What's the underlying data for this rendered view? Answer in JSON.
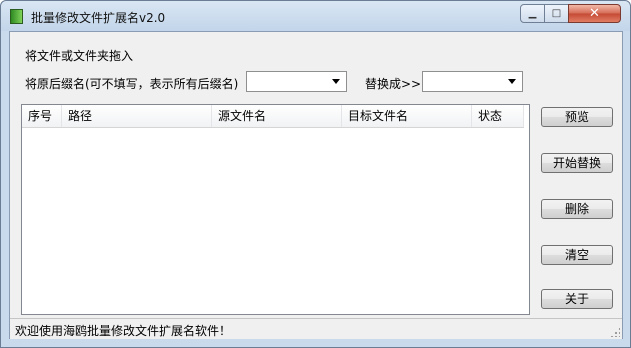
{
  "window": {
    "title": "批量修改文件扩展名v2.0",
    "caption": {
      "min_icon": "minimize-icon",
      "max_icon": "maximize-icon",
      "close_icon": "close-icon"
    }
  },
  "form": {
    "drop_hint": "将文件或文件夹拖入",
    "original_label": "将原后缀名(可不填写，表示所有后缀名)",
    "original_value": "",
    "replace_label": "替换成>>",
    "replace_value": ""
  },
  "table": {
    "columns": [
      "序号",
      "路径",
      "源文件名",
      "目标文件名",
      "状态"
    ],
    "rows": []
  },
  "buttons": {
    "preview": "预览",
    "start_replace": "开始替换",
    "delete": "删除",
    "clear": "清空",
    "about": "关于"
  },
  "status": {
    "text": "欢迎使用海鸥批量修改文件扩展名软件！"
  },
  "colors": {
    "title_bar": "#c9daec",
    "close_button": "#c54a35",
    "client_bg": "#f0f0f0"
  }
}
